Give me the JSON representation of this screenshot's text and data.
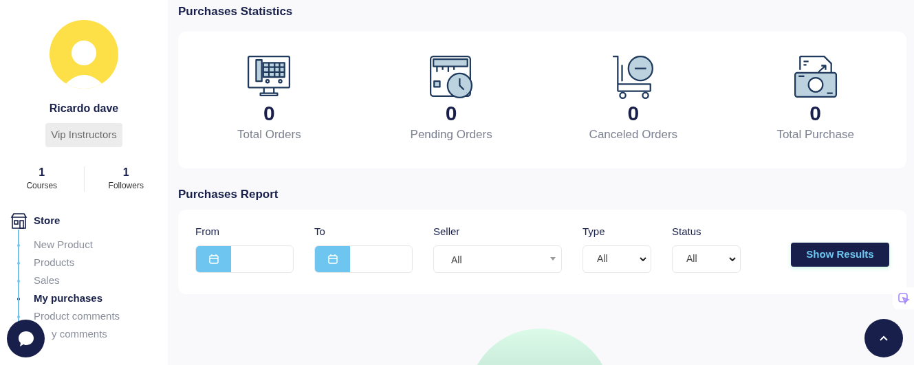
{
  "profile": {
    "name": "Ricardo dave",
    "badge": "Vip Instructors",
    "stats": [
      {
        "value": "1",
        "label": "Courses"
      },
      {
        "value": "1",
        "label": "Followers"
      }
    ]
  },
  "menu": {
    "title": "Store",
    "items": [
      {
        "label": "New Product",
        "selected": false
      },
      {
        "label": "Products",
        "selected": false
      },
      {
        "label": "Sales",
        "selected": false
      },
      {
        "label": "My purchases",
        "selected": true
      },
      {
        "label": "Product comments",
        "selected": false
      },
      {
        "label": "y comments",
        "selected": false
      }
    ]
  },
  "statistics": {
    "title": "Purchases Statistics",
    "items": [
      {
        "kind": "monitor",
        "value": "0",
        "label": "Total Orders"
      },
      {
        "kind": "clock",
        "value": "0",
        "label": "Pending Orders"
      },
      {
        "kind": "cart",
        "value": "0",
        "label": "Canceled Orders"
      },
      {
        "kind": "money",
        "value": "0",
        "label": "Total Purchase"
      }
    ]
  },
  "report": {
    "title": "Purchases Report",
    "from_label": "From",
    "to_label": "To",
    "seller": {
      "label": "Seller",
      "value": "All"
    },
    "type": {
      "label": "Type",
      "value": "All"
    },
    "status": {
      "label": "Status",
      "value": "All"
    },
    "button": "Show Results"
  }
}
